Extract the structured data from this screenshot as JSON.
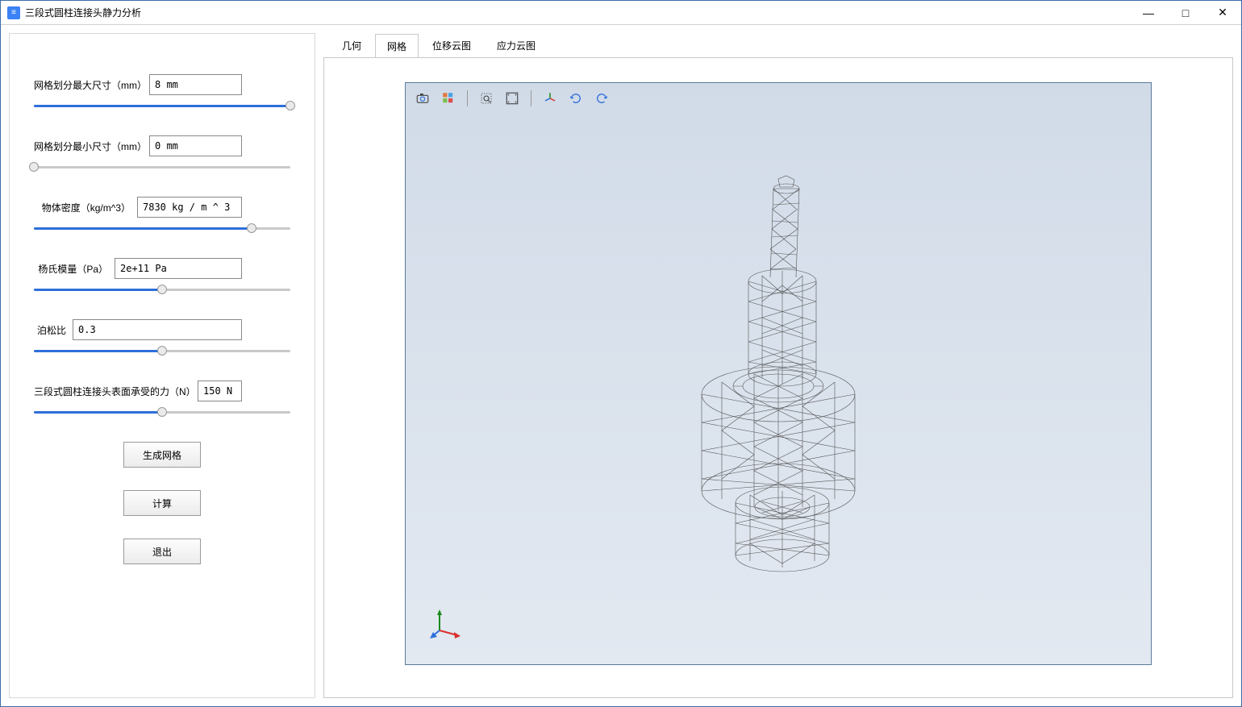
{
  "window": {
    "title": "三段式圆柱连接头静力分析",
    "min_label": "—",
    "max_label": "□",
    "close_label": "✕"
  },
  "params": {
    "mesh_max": {
      "label": "网格划分最大尺寸（mm）",
      "value": "8 mm",
      "slider_pct": 100
    },
    "mesh_min": {
      "label": "网格划分最小尺寸（mm）",
      "value": "0 mm",
      "slider_pct": 0
    },
    "density": {
      "label": "物体密度（kg/m^3）",
      "value": "7830 kg / m ^ 3",
      "slider_pct": 85
    },
    "youngs": {
      "label": "杨氏模量（Pa）",
      "value": "2e+11 Pa",
      "slider_pct": 50
    },
    "poisson": {
      "label": "泊松比",
      "value": "0.3",
      "slider_pct": 50
    },
    "force": {
      "label": "三段式圆柱连接头表面承受的力（N）",
      "value": "150 N",
      "slider_pct": 50
    }
  },
  "buttons": {
    "gen_mesh": "生成网格",
    "calc": "计算",
    "exit": "退出"
  },
  "tabs": {
    "items": [
      "几何",
      "网格",
      "位移云图",
      "应力云图"
    ],
    "active_index": 1
  },
  "toolbar_icons": [
    "camera-icon",
    "palette-icon",
    "zoom-box-icon",
    "fit-screen-icon",
    "axes-icon",
    "rotate-left-icon",
    "rotate-right-icon"
  ]
}
